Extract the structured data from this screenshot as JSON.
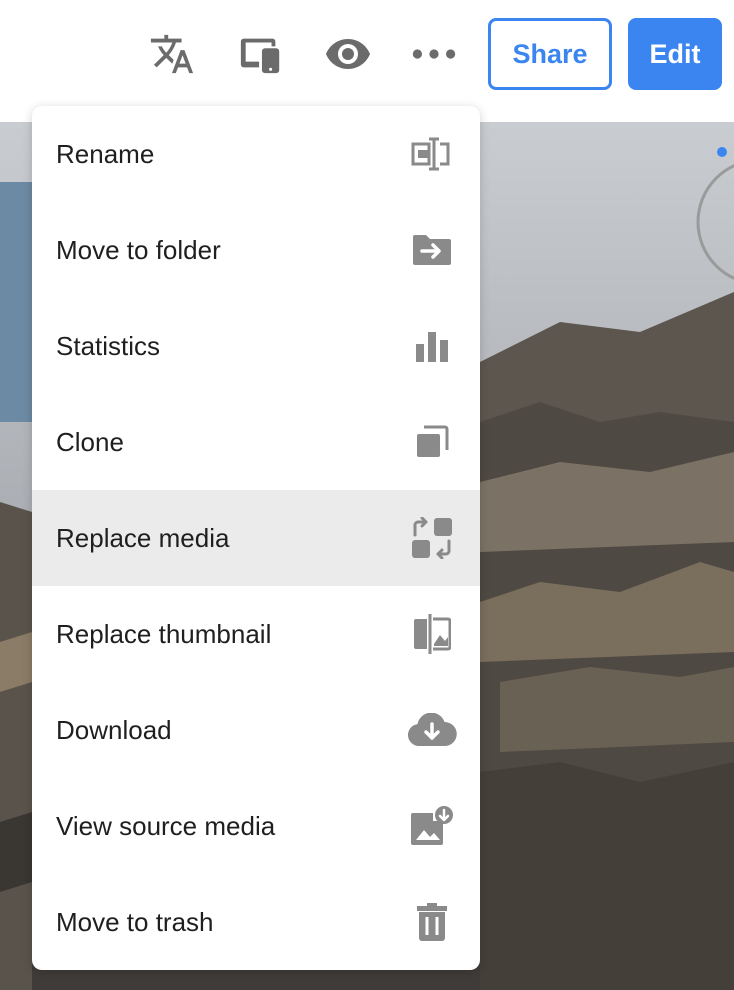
{
  "toolbar": {
    "icons": [
      {
        "name": "translate-icon"
      },
      {
        "name": "devices-icon"
      },
      {
        "name": "preview-eye-icon"
      },
      {
        "name": "more-options-icon"
      }
    ],
    "share_label": "Share",
    "edit_label": "Edit",
    "accent_color": "#3a85f0"
  },
  "menu": {
    "active_item": "Replace media",
    "items": [
      {
        "label": "Rename",
        "icon": "rename-icon"
      },
      {
        "label": "Move to folder",
        "icon": "move-folder-icon"
      },
      {
        "label": "Statistics",
        "icon": "bar-chart-icon"
      },
      {
        "label": "Clone",
        "icon": "clone-icon"
      },
      {
        "label": "Replace media",
        "icon": "replace-media-icon"
      },
      {
        "label": "Replace thumbnail",
        "icon": "replace-thumbnail-icon"
      },
      {
        "label": "Download",
        "icon": "cloud-download-icon"
      },
      {
        "label": "View source media",
        "icon": "view-source-media-icon"
      },
      {
        "label": "Move to trash",
        "icon": "trash-icon"
      }
    ]
  }
}
